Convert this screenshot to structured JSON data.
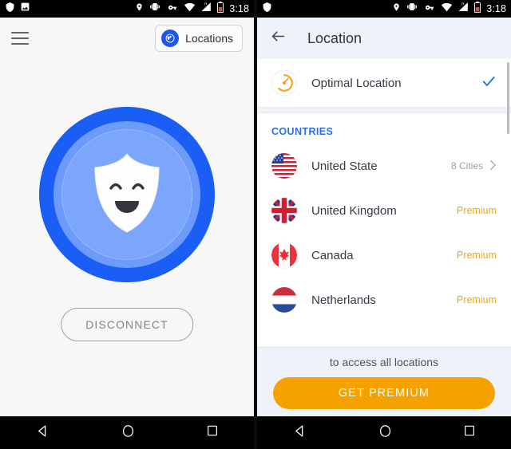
{
  "status_bar": {
    "time": "3:18",
    "left_icons": [
      "shield-icon",
      "image-icon"
    ],
    "right_icons": [
      "location-pin-icon",
      "vibrate-icon",
      "vpn-key-icon",
      "wifi-icon",
      "cellular-signal-roaming-icon",
      "battery-icon"
    ]
  },
  "left_screen": {
    "menu_icon": "hamburger-menu-icon",
    "locations_button": {
      "label": "Locations",
      "icon": "globe-icon"
    },
    "connection": {
      "state_icon": "shield-mascot-smiling-icon",
      "button_label": "DISCONNECT"
    },
    "colors": {
      "outer_ring": "#1a5ef5",
      "mid_ring": "#6c9bfb",
      "inner_ring": "#7ba6fc",
      "background": "#f7f7f7"
    }
  },
  "right_screen": {
    "header": {
      "back_icon": "back-arrow-icon",
      "title": "Location"
    },
    "optimal": {
      "label": "Optimal Location",
      "icon": "speedometer-icon",
      "selected_icon": "check-icon",
      "selected": true
    },
    "section_header": "COUNTRIES",
    "countries": [
      {
        "name": "United State",
        "flag": "flag-us",
        "meta": "8 Cities",
        "type": "cities",
        "chevron": "chevron-right-icon"
      },
      {
        "name": "United Kingdom",
        "flag": "flag-uk",
        "meta": "Premium",
        "type": "premium"
      },
      {
        "name": "Canada",
        "flag": "flag-ca",
        "meta": "Premium",
        "type": "premium"
      },
      {
        "name": "Netherlands",
        "flag": "flag-nl",
        "meta": "Premium",
        "type": "premium"
      }
    ],
    "promo": {
      "text": "to access all locations",
      "button_label": "GET PREMIUM"
    },
    "colors": {
      "accent_blue": "#2b6cf0",
      "premium_orange": "#f0a21b",
      "button_orange": "#f5a200",
      "header_bg": "#eef2fa"
    }
  },
  "nav_bar": {
    "back": "back-triangle-icon",
    "home": "home-circle-icon",
    "recents": "recents-square-icon"
  }
}
